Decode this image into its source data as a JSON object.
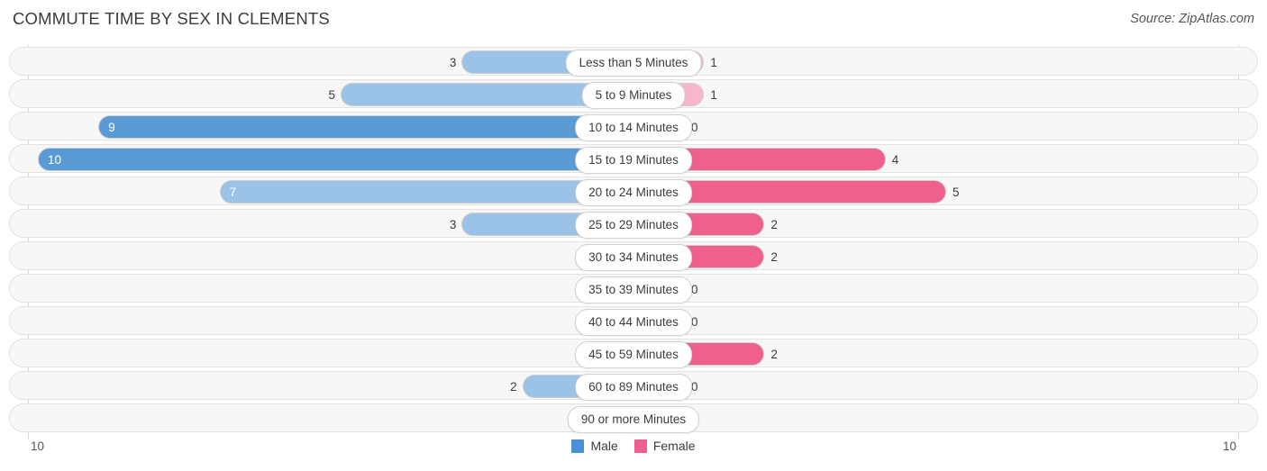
{
  "header": {
    "title": "COMMUTE TIME BY SEX IN CLEMENTS",
    "source": "Source: ZipAtlas.com"
  },
  "axis": {
    "left_label": "10",
    "right_label": "10"
  },
  "legend": {
    "male_label": "Male",
    "female_label": "Female",
    "male_color": "#4a90d9",
    "female_color": "#ef5f8e"
  },
  "colors": {
    "male_dark": "#5b9bd5",
    "male_light": "#9bc3e8",
    "female_dark": "#f0608d",
    "female_light": "#f8b6cb",
    "track": "#f7f7f7",
    "track_border": "#e3e3e3"
  },
  "chart_data": {
    "type": "bar",
    "orientation": "horizontal-diverging",
    "title": "COMMUTE TIME BY SEX IN CLEMENTS",
    "xlabel": "",
    "ylabel": "",
    "xlim": [
      10,
      10
    ],
    "grid": true,
    "legend_position": "bottom-center",
    "categories": [
      "Less than 5 Minutes",
      "5 to 9 Minutes",
      "10 to 14 Minutes",
      "15 to 19 Minutes",
      "20 to 24 Minutes",
      "25 to 29 Minutes",
      "30 to 34 Minutes",
      "35 to 39 Minutes",
      "40 to 44 Minutes",
      "45 to 59 Minutes",
      "60 to 89 Minutes",
      "90 or more Minutes"
    ],
    "series": [
      {
        "name": "Male",
        "values": [
          3,
          5,
          9,
          10,
          7,
          3,
          0,
          0,
          0,
          0,
          2,
          0
        ]
      },
      {
        "name": "Female",
        "values": [
          1,
          1,
          0,
          4,
          5,
          2,
          2,
          0,
          0,
          2,
          0,
          0
        ]
      }
    ]
  },
  "rows": [
    {
      "label": "Less than 5 Minutes",
      "male": "3",
      "female": "1"
    },
    {
      "label": "5 to 9 Minutes",
      "male": "5",
      "female": "1"
    },
    {
      "label": "10 to 14 Minutes",
      "male": "9",
      "female": "0"
    },
    {
      "label": "15 to 19 Minutes",
      "male": "10",
      "female": "4"
    },
    {
      "label": "20 to 24 Minutes",
      "male": "7",
      "female": "5"
    },
    {
      "label": "25 to 29 Minutes",
      "male": "3",
      "female": "2"
    },
    {
      "label": "30 to 34 Minutes",
      "male": "0",
      "female": "2"
    },
    {
      "label": "35 to 39 Minutes",
      "male": "0",
      "female": "0"
    },
    {
      "label": "40 to 44 Minutes",
      "male": "0",
      "female": "0"
    },
    {
      "label": "45 to 59 Minutes",
      "male": "0",
      "female": "2"
    },
    {
      "label": "60 to 89 Minutes",
      "male": "2",
      "female": "0"
    },
    {
      "label": "90 or more Minutes",
      "male": "0",
      "female": "0"
    }
  ]
}
